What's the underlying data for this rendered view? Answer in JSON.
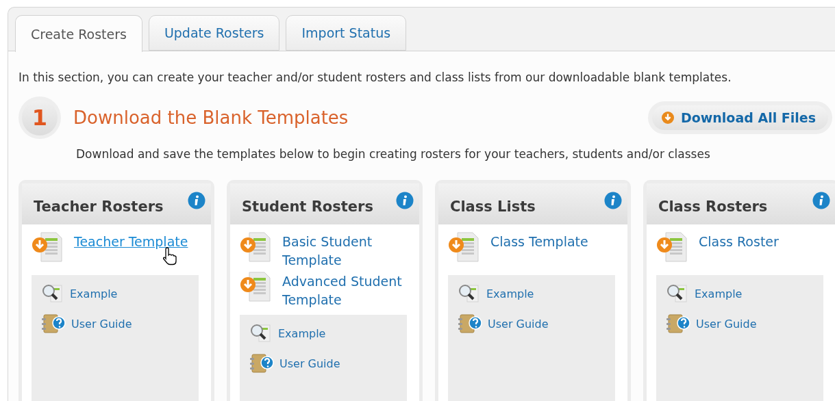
{
  "tabs": [
    {
      "label": "Create Rosters",
      "selected": true
    },
    {
      "label": "Update Rosters",
      "selected": false
    },
    {
      "label": "Import Status",
      "selected": false
    }
  ],
  "intro": "In this section, you can create your teacher and/or student rosters and class lists from our downloadable blank templates.",
  "step": {
    "number": "1",
    "title": "Download the Blank Templates",
    "subtitle": "Download and save the templates below to begin creating rosters for your teachers, students and/or classes",
    "button": "Download All Files"
  },
  "cards": [
    {
      "title": "Teacher Rosters",
      "templates": [
        {
          "label": "Teacher Template",
          "hovered": true
        }
      ],
      "links": [
        {
          "kind": "example",
          "label": "Example"
        },
        {
          "kind": "guide",
          "label": "User Guide"
        }
      ]
    },
    {
      "title": "Student Rosters",
      "templates": [
        {
          "label": "Basic Student Template",
          "hovered": false
        },
        {
          "label": "Advanced Student Template",
          "hovered": false
        }
      ],
      "links": [
        {
          "kind": "example",
          "label": "Example"
        },
        {
          "kind": "guide",
          "label": "User Guide"
        }
      ]
    },
    {
      "title": "Class Lists",
      "templates": [
        {
          "label": "Class Template",
          "hovered": false
        }
      ],
      "links": [
        {
          "kind": "example",
          "label": "Example"
        },
        {
          "kind": "guide",
          "label": "User Guide"
        }
      ]
    },
    {
      "title": "Class Rosters",
      "templates": [
        {
          "label": "Class Roster",
          "hovered": false
        }
      ],
      "links": [
        {
          "kind": "example",
          "label": "Example"
        },
        {
          "kind": "guide",
          "label": "User Guide"
        }
      ]
    }
  ]
}
